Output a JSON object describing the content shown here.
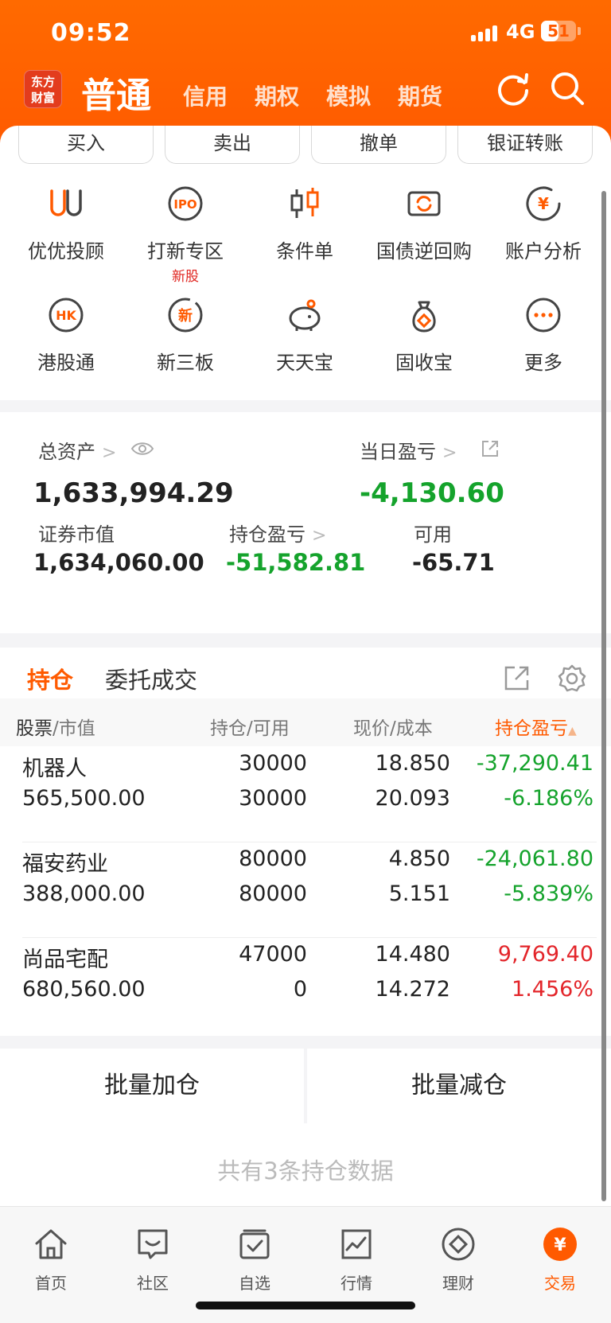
{
  "status": {
    "time": "09:52",
    "network": "4G",
    "battery": "51",
    "battery_fraction": 0.51
  },
  "header": {
    "logo_line1": "东方",
    "logo_line2": "财富",
    "tabs": [
      "普通",
      "信用",
      "期权",
      "模拟",
      "期货"
    ]
  },
  "actions": [
    "买入",
    "卖出",
    "撤单",
    "银证转账"
  ],
  "shortcuts": [
    {
      "label": "优优投顾",
      "icon": "uu-advisor-icon"
    },
    {
      "label": "打新专区",
      "icon": "ipo-icon",
      "badge": "新股"
    },
    {
      "label": "条件单",
      "icon": "candlestick-icon"
    },
    {
      "label": "国债逆回购",
      "icon": "repo-icon"
    },
    {
      "label": "账户分析",
      "icon": "yen-chart-icon"
    },
    {
      "label": "港股通",
      "icon": "hk-icon"
    },
    {
      "label": "新三板",
      "icon": "new-board-icon"
    },
    {
      "label": "天天宝",
      "icon": "piggy-bank-icon"
    },
    {
      "label": "固收宝",
      "icon": "money-bag-icon"
    },
    {
      "label": "更多",
      "icon": "more-icon"
    }
  ],
  "assets": {
    "total_label": "总资产",
    "total_value": "1,633,994.29",
    "daily_label": "当日盈亏",
    "daily_value": "-4,130.60",
    "market_label": "证券市值",
    "market_value": "1,634,060.00",
    "holding_pl_label": "持仓盈亏",
    "holding_pl_value": "-51,582.81",
    "available_label": "可用",
    "available_value": "-65.71"
  },
  "holdings": {
    "tab_active": "持仓",
    "tab_other": "委托成交",
    "col1_a": "股票",
    "col1_b": "/市值",
    "col2_a": "持仓",
    "col2_b": "/可用",
    "col3_a": "现价",
    "col3_b": "/成本",
    "col4": "持仓盈亏",
    "rows": [
      {
        "name": "机器人",
        "mv": "565,500.00",
        "pos": "30000",
        "avail": "30000",
        "price": "18.850",
        "cost": "20.093",
        "pl": "-37,290.41",
        "plpct": "-6.186%"
      },
      {
        "name": "福安药业",
        "mv": "388,000.00",
        "pos": "80000",
        "avail": "80000",
        "price": "4.850",
        "cost": "5.151",
        "pl": "-24,061.80",
        "plpct": "-5.839%"
      },
      {
        "name": "尚品宅配",
        "mv": "680,560.00",
        "pos": "47000",
        "avail": "0",
        "price": "14.480",
        "cost": "14.272",
        "pl": "9,769.40",
        "plpct": "1.456%"
      }
    ]
  },
  "batch": {
    "add": "批量加仓",
    "reduce": "批量减仓"
  },
  "footer_note": "共有3条持仓数据",
  "nav": [
    "首页",
    "社区",
    "自选",
    "行情",
    "理财",
    "交易"
  ],
  "colors": {
    "brand": "#ff5a00",
    "down": "#15a32c",
    "up": "#e3252a"
  }
}
